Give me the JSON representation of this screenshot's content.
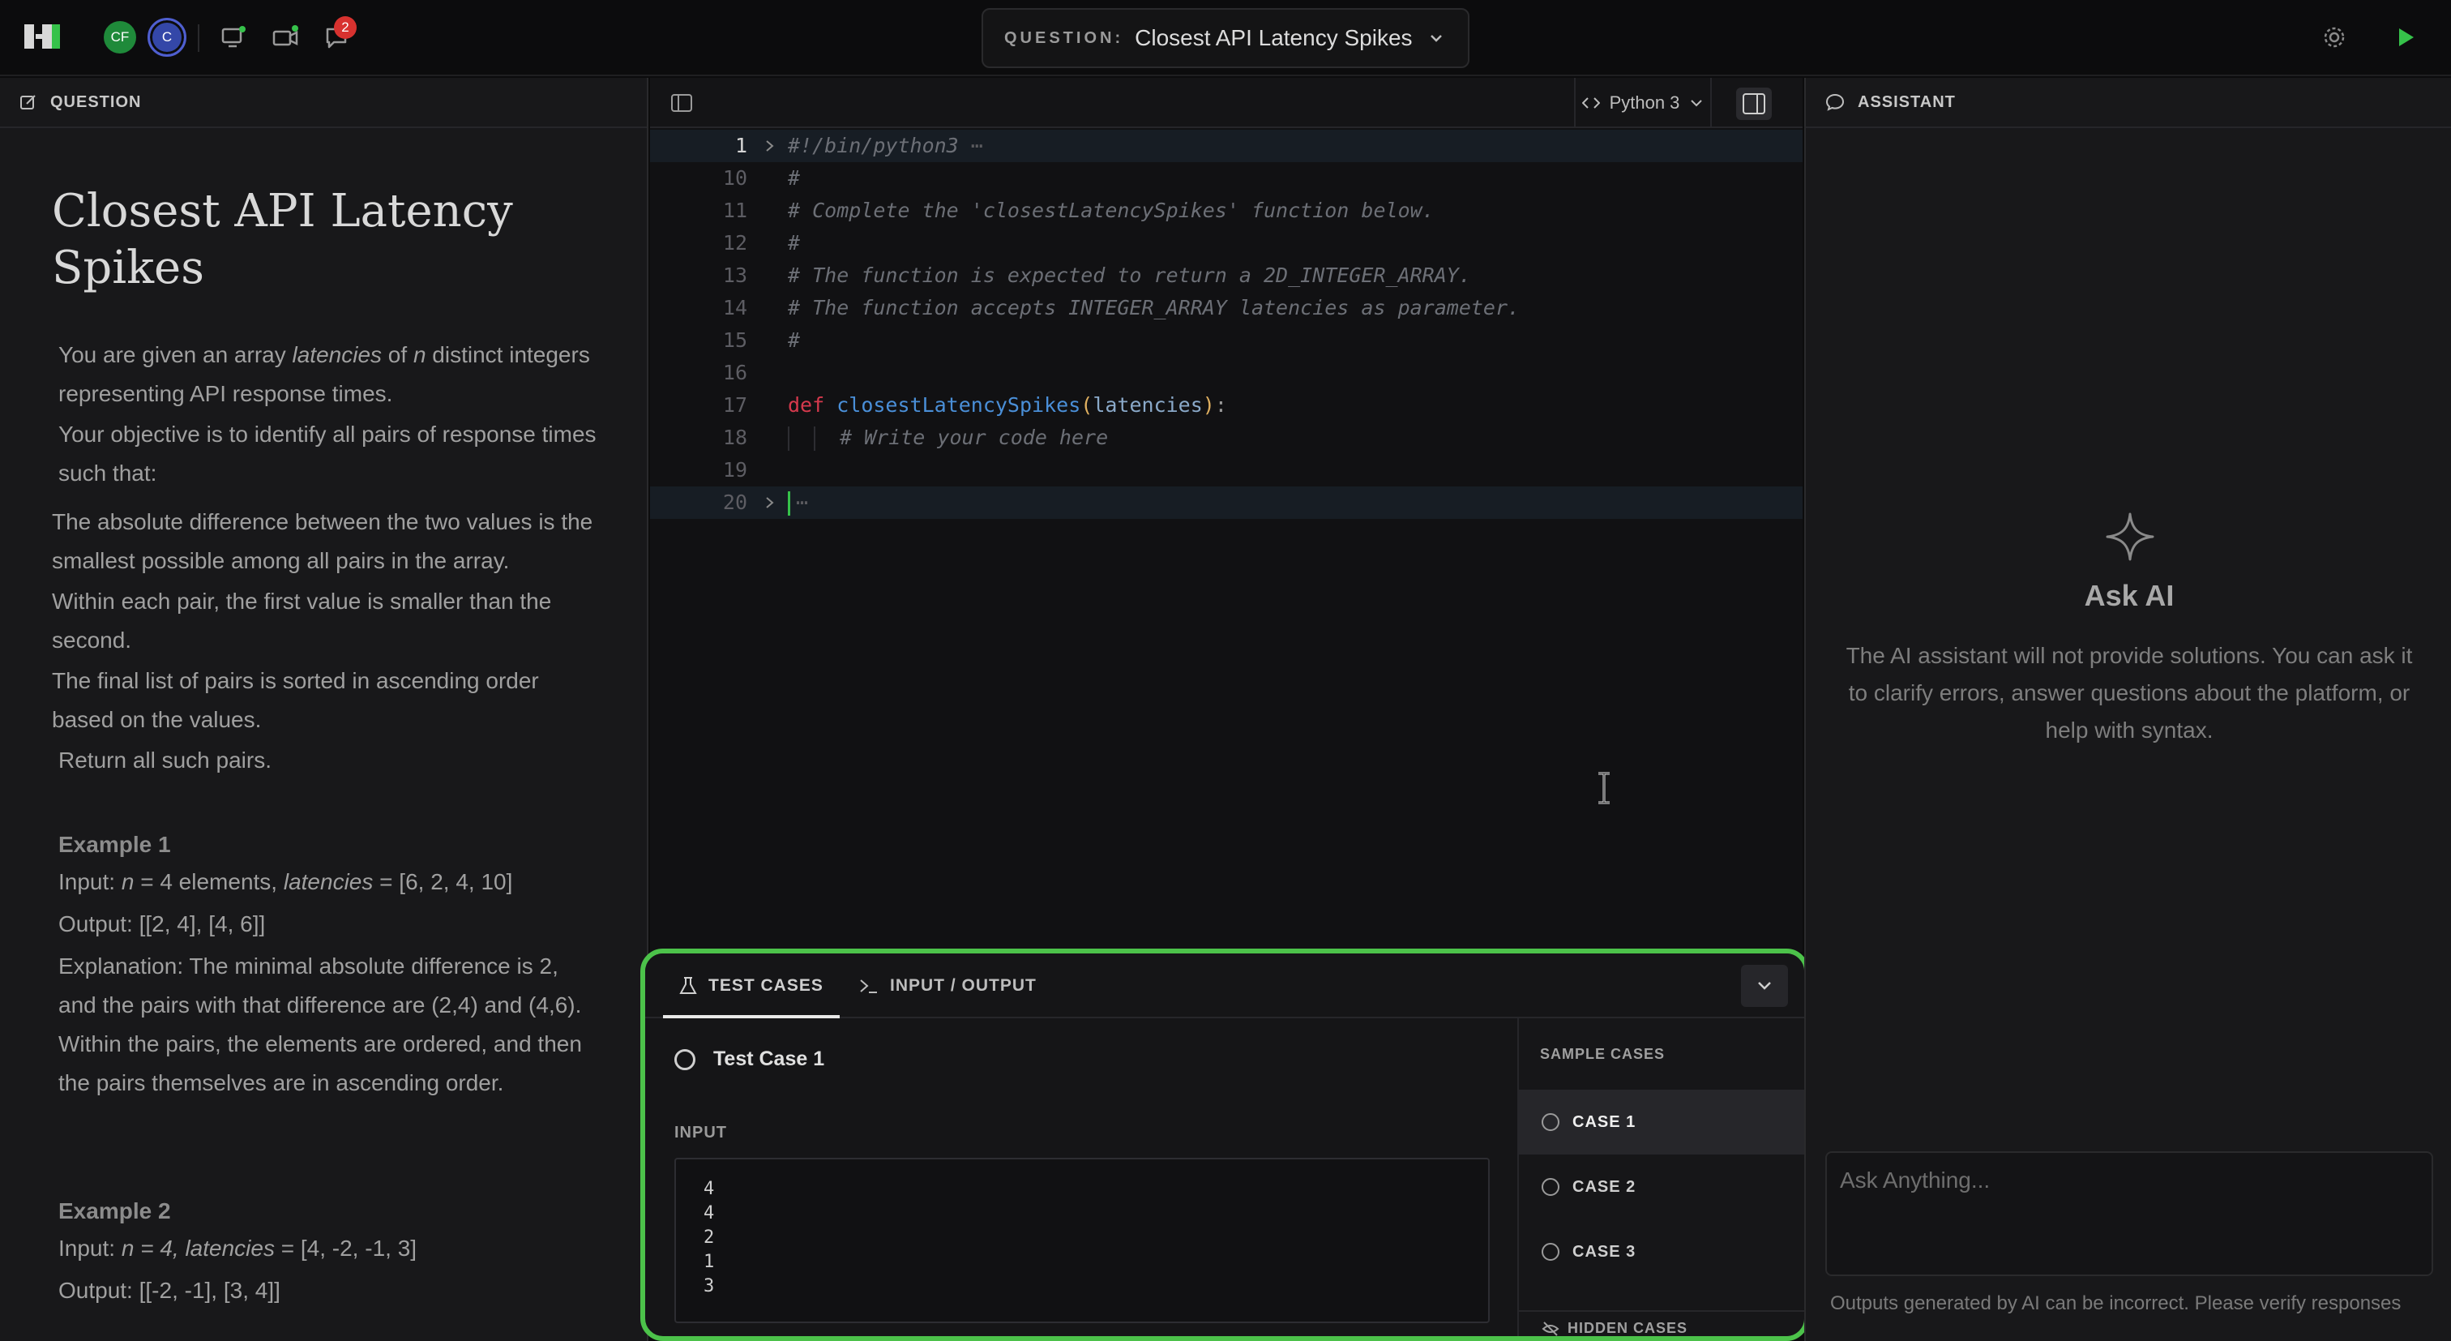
{
  "topbar": {
    "avatars": [
      "CF",
      "C"
    ],
    "notification_count": "2",
    "question_label": "QUESTION:",
    "question_title": "Closest API Latency Spikes"
  },
  "left": {
    "header": "QUESTION",
    "title": "Closest API Latency Spikes",
    "intro1_a": "You are given an array ",
    "intro1_em1": "latencies",
    "intro1_b": " of ",
    "intro1_em2": "n",
    "intro1_c": " distinct integers representing API response times.",
    "intro2": "Your objective is to identify all pairs of response times such that:",
    "rule1": "The absolute difference between the two values is the smallest possible among all pairs in the array.",
    "rule2": "Within each pair, the first value is smaller than the second.",
    "rule3": "The final list of pairs is sorted in ascending order based on the values.",
    "return": "Return all such pairs.",
    "example1": {
      "heading": "Example 1",
      "input_a": "Input: ",
      "input_n": "n",
      "input_b": " = 4 elements, ",
      "input_lat": "latencies",
      "input_c": " = [6, 2, 4, 10]",
      "output": "Output: [[2, 4], [4, 6]]",
      "explanation": "Explanation: The minimal absolute difference is 2, and the pairs with that difference are (2,4) and (4,6). Within the pairs, the elements are ordered, and then the pairs themselves are in ascending order."
    },
    "example2": {
      "heading": "Example 2",
      "input_a": "Input: ",
      "input_em": "n = 4, latencies",
      "input_c": " = [4, -2, -1, 3]",
      "output": "Output: [[-2, -1], [3, 4]]"
    }
  },
  "editor": {
    "language": "Python 3",
    "lines": [
      {
        "num": "1",
        "text": "#!/bin/python3"
      },
      {
        "num": "10",
        "text": "#"
      },
      {
        "num": "11",
        "text": "# Complete the 'closestLatencySpikes' function below."
      },
      {
        "num": "12",
        "text": "#"
      },
      {
        "num": "13",
        "text": "# The function is expected to return a 2D_INTEGER_ARRAY."
      },
      {
        "num": "14",
        "text": "# The function accepts INTEGER_ARRAY latencies as parameter."
      },
      {
        "num": "15",
        "text": "#"
      },
      {
        "num": "16",
        "text": ""
      },
      {
        "num": "17",
        "kw": "def",
        "fn": "closestLatencySpikes",
        "param": "latencies"
      },
      {
        "num": "18",
        "text": "# Write your code here"
      },
      {
        "num": "19",
        "text": ""
      },
      {
        "num": "20",
        "text": ""
      }
    ]
  },
  "tests": {
    "tab_tests": "TEST CASES",
    "tab_io": "INPUT / OUTPUT",
    "case_title": "Test Case 1",
    "input_label": "INPUT",
    "input_lines": [
      "4",
      "4",
      "2",
      "1",
      "3"
    ],
    "sample_header": "SAMPLE CASES",
    "cases": [
      "CASE 1",
      "CASE 2",
      "CASE 3"
    ],
    "hidden": "HIDDEN CASES"
  },
  "assistant": {
    "header": "ASSISTANT",
    "title": "Ask AI",
    "desc": "The AI assistant will not provide solutions. You can ask it to clarify errors, answer questions about the platform, or help with syntax.",
    "placeholder": "Ask Anything...",
    "note": "Outputs generated by AI can be incorrect. Please verify responses"
  },
  "colors": {
    "accent_green": "#4cc24a",
    "keyword_red": "#d6394d",
    "function_blue": "#4a8fd8",
    "badge_red": "#d8322f"
  },
  "icons": [
    "logo",
    "avatar",
    "screen-share-icon",
    "video-icon",
    "chat-icon",
    "chevron-down-icon",
    "gear-icon",
    "play-icon",
    "edit-icon",
    "sidebar-toggle-icon",
    "code-icon",
    "flask-icon",
    "terminal-icon",
    "sparkle-icon",
    "message-icon",
    "eye-off-icon",
    "text-cursor-icon"
  ]
}
